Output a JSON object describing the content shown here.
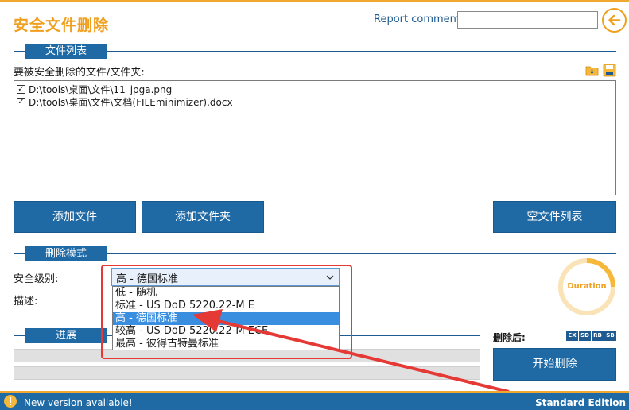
{
  "app": {
    "title": "安全文件删除",
    "report_label": "Report comment:",
    "report_value": ""
  },
  "file_section": {
    "tab_label": "文件列表",
    "prompt": "要被安全删除的文件/文件夹:",
    "files": [
      {
        "checked": true,
        "path": "D:\\tools\\桌面\\文件\\11_jpga.png"
      },
      {
        "checked": true,
        "path": "D:\\tools\\桌面\\文件\\文档(FILEminimizer).docx"
      }
    ],
    "add_file_label": "添加文件",
    "add_folder_label": "添加文件夹",
    "clear_list_label": "空文件列表"
  },
  "delete_mode": {
    "tab_label": "删除模式",
    "level_label": "安全级别:",
    "desc_label": "描述:",
    "selected": "高 - 德国标准",
    "options": [
      "低 - 随机",
      "标准 - US DoD 5220.22-M E",
      "高 - 德国标准",
      "较高 - US DoD 5220.22-M ECE",
      "最高 - 彼得古特曼标准"
    ],
    "selected_index": 2,
    "duration_label": "Duration"
  },
  "progress": {
    "tab_label": "进展",
    "after_label": "删除后:",
    "after_buttons": [
      "EX",
      "SD",
      "RB",
      "SB"
    ],
    "start_label": "开始删除",
    "bar1": 0,
    "bar2": 0
  },
  "status": {
    "message": "New version available!",
    "edition": "Standard Edition"
  },
  "colors": {
    "accent": "#f0a020",
    "primary": "#1f6aa5",
    "annotation": "#e53935"
  }
}
